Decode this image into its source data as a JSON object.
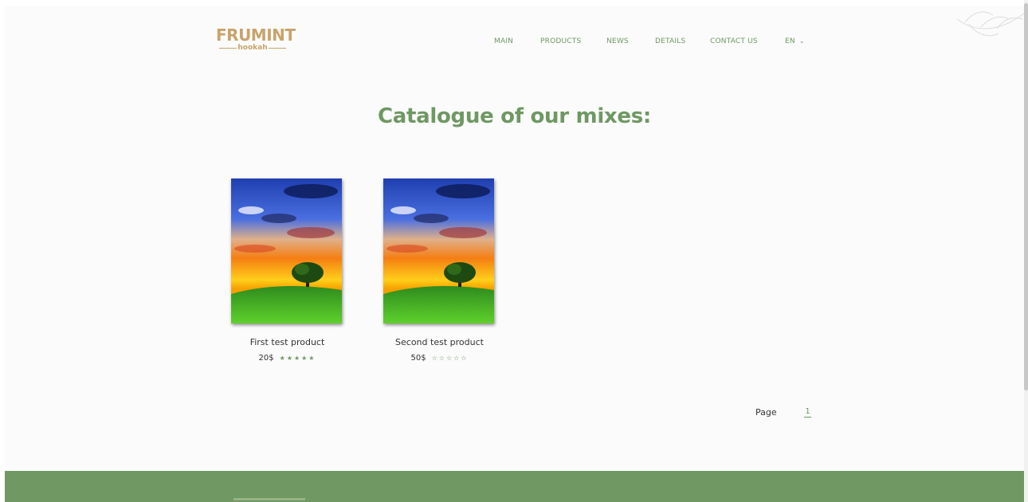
{
  "header": {
    "logo": {
      "main": "FRUMINT",
      "sub": "hookah"
    },
    "nav": [
      {
        "label": "MAIN"
      },
      {
        "label": "PRODUCTS"
      },
      {
        "label": "NEWS"
      },
      {
        "label": "DETAILS"
      },
      {
        "label": "CONTACT US"
      }
    ],
    "language": {
      "label": "EN",
      "icon": "chevron-down-icon"
    }
  },
  "catalog": {
    "title": "Catalogue of our mixes:",
    "products": [
      {
        "name": "First test product",
        "price": "20$",
        "rating": 5,
        "max_rating": 5
      },
      {
        "name": "Second test product",
        "price": "50$",
        "rating": 0,
        "max_rating": 5
      }
    ]
  },
  "pagination": {
    "label": "Page",
    "current": "1"
  },
  "theme": {
    "accent": "#6f9863",
    "logo": "#c9a36b",
    "footer": "#6f9863",
    "background": "#fbfbfb"
  }
}
